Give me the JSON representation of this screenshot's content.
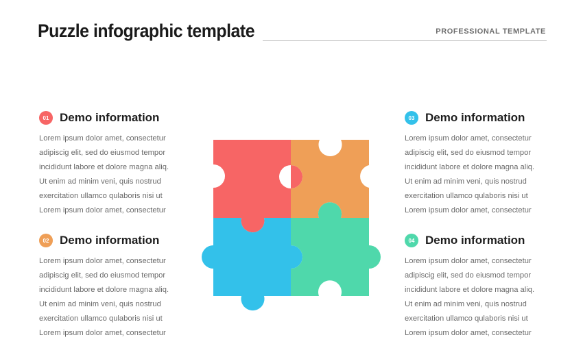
{
  "header": {
    "title": "Puzzle infographic template",
    "tag": "PROFESSIONAL TEMPLATE"
  },
  "colors": {
    "red": "#f76565",
    "orange": "#ef9f57",
    "blue": "#33c1ea",
    "green": "#4fd8ab"
  },
  "blocks": [
    {
      "number": "01",
      "title": "Demo information",
      "lines": [
        "Lorem ipsum dolor amet, consectetur",
        "adipiscig elit, sed do eiusmod tempor",
        "incididunt  labore et dolore magna aliq.",
        "Ut enim ad minim veni, quis nostrud",
        "exercitation ullamco qulaboris nisi ut",
        "Lorem ipsum dolor amet, consectetur"
      ]
    },
    {
      "number": "02",
      "title": "Demo information",
      "lines": [
        "Lorem ipsum dolor amet, consectetur",
        "adipiscig elit, sed do eiusmod tempor",
        "incididunt  labore et dolore magna aliq.",
        "Ut enim ad minim veni, quis nostrud",
        "exercitation ullamco qulaboris nisi ut",
        "Lorem ipsum dolor amet, consectetur"
      ]
    },
    {
      "number": "03",
      "title": "Demo information",
      "lines": [
        "Lorem ipsum dolor amet, consectetur",
        "adipiscig elit, sed do eiusmod tempor",
        "incididunt  labore et dolore magna aliq.",
        "Ut enim ad minim veni, quis nostrud",
        "exercitation ullamco qulaboris nisi ut",
        "Lorem ipsum dolor amet, consectetur"
      ]
    },
    {
      "number": "04",
      "title": "Demo information",
      "lines": [
        "Lorem ipsum dolor amet, consectetur",
        "adipiscig elit, sed do eiusmod tempor",
        "incididunt  labore et dolore magna aliq.",
        "Ut enim ad minim veni, quis nostrud",
        "exercitation ullamco qulaboris nisi ut",
        "Lorem ipsum dolor amet, consectetur"
      ]
    }
  ]
}
